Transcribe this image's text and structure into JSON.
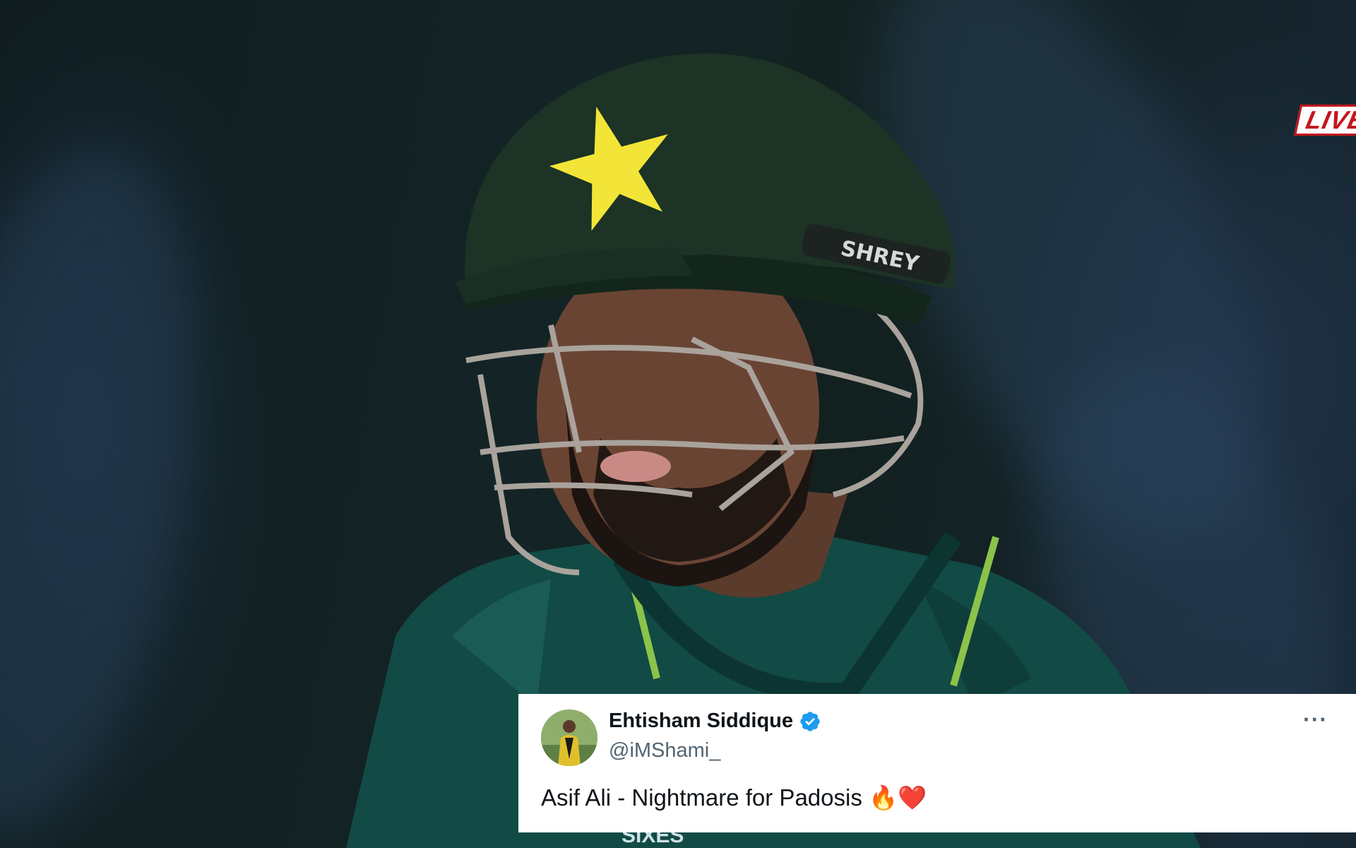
{
  "overlay": {
    "live_label": "LIVE",
    "helmet_brand": "SHREY",
    "jersey_text": "SIXES"
  },
  "tweet": {
    "display_name": "Ehtisham Siddique",
    "handle": "@iMShami_",
    "text": "Asif Ali - Nightmare for Padosis 🔥❤️",
    "more_label": "···"
  },
  "colors": {
    "verified": "#1d9bf0",
    "live_red": "#c4161c",
    "helmet": "#1c3325",
    "jersey": "#124a45"
  },
  "icons": {
    "verified": "verified-badge-icon",
    "more": "more-options-icon"
  }
}
